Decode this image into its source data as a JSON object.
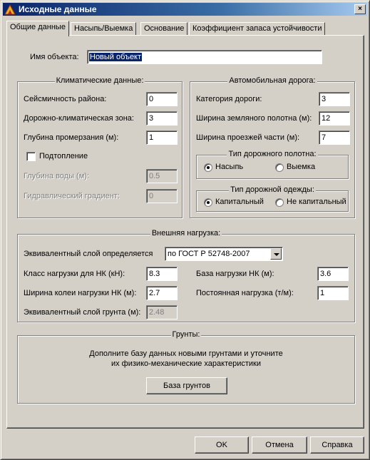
{
  "window": {
    "title": "Исходные данные",
    "close_label": "×"
  },
  "tabs": [
    {
      "label": "Общие данные"
    },
    {
      "label": "Насыпь/Выемка"
    },
    {
      "label": "Основание"
    },
    {
      "label": "Коэффициент запаса устойчивости"
    }
  ],
  "object": {
    "label": "Имя объекта:",
    "value": "Новый объект"
  },
  "climate": {
    "title": "Климатические данные:",
    "seismic_label": "Сейсмичность района:",
    "seismic_value": "0",
    "zone_label": "Дорожно-климатическая зона:",
    "zone_value": "3",
    "freeze_label": "Глубина промерзания (м):",
    "freeze_value": "1",
    "flooding_label": "Подтопление",
    "flooding_checked": false,
    "water_label": "Глубина воды (м):",
    "water_value": "0.5",
    "gradient_label": "Гидравлический градиент:",
    "gradient_value": "0"
  },
  "road": {
    "title": "Автомобильная дорога:",
    "category_label": "Категория дороги:",
    "category_value": "3",
    "subgrade_label": "Ширина земляного полотна (м):",
    "subgrade_value": "12",
    "carriage_label": "Ширина проезжей части (м):",
    "carriage_value": "7",
    "bed_type": {
      "title": "Тип дорожного полотна:",
      "option1": "Насыпь",
      "option2": "Выемка",
      "selected": "Насыпь"
    },
    "pavement_type": {
      "title": "Тип дорожной одежды:",
      "option1": "Капитальный",
      "option2": "Не капитальный",
      "selected": "Капитальный"
    }
  },
  "load": {
    "title": "Внешняя нагрузка:",
    "equiv_label": "Эквивалентный слой определяется",
    "equiv_selected": "по ГОСТ Р 52748-2007",
    "class_label": "Класс нагрузки для НК (кН):",
    "class_value": "8.3",
    "base_label": "База нагрузки НК (м):",
    "base_value": "3.6",
    "gauge_label": "Ширина колеи нагрузки НК (м):",
    "gauge_value": "2.7",
    "const_label": "Постоянная нагрузка (т/м):",
    "const_value": "1",
    "soil_layer_label": "Эквивалентный слой грунта (м):",
    "soil_layer_value": "2.48"
  },
  "soils": {
    "title": "Грунты:",
    "hint_line1": "Дополните базу данных новыми грунтами и уточните",
    "hint_line2": "их физико-механические характеристики",
    "button": "База грунтов"
  },
  "buttons": {
    "ok": "OK",
    "cancel": "Отмена",
    "help": "Справка"
  },
  "colors": {
    "title_bar": "#0a246a",
    "face": "#d4d0c8",
    "selection": "#0a246a"
  }
}
